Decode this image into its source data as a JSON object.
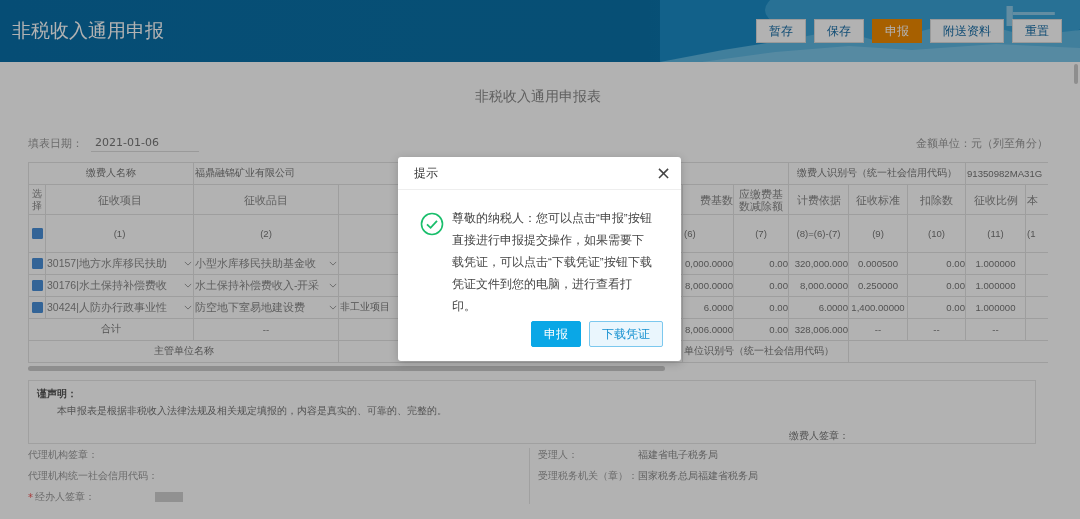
{
  "header": {
    "title": "非税收入通用申报",
    "buttons": [
      {
        "label": "暂存",
        "kind": "plain"
      },
      {
        "label": "保存",
        "kind": "plain"
      },
      {
        "label": "申报",
        "kind": "accent"
      },
      {
        "label": "附送资料",
        "kind": "plain"
      },
      {
        "label": "重置",
        "kind": "plain"
      }
    ]
  },
  "form": {
    "title": "非税收入通用申报表",
    "date_label": "填表日期：",
    "date_value": "2021-01-06",
    "unit_note": "金额单位：元（列至角分）",
    "payer_name_label": "缴费人名称",
    "payer_name": "福鼎融锦矿业有限公司",
    "payer_id_label": "缴费人识别号（统一社会信用代码）",
    "payer_id": "91350982MA31G",
    "columns": [
      {
        "label": "选择"
      },
      {
        "label": "征收项目",
        "number": "(1)"
      },
      {
        "label": "征收品目",
        "number": "(2)"
      },
      {
        "label": "费基数",
        "number": "(6)"
      },
      {
        "label": "应缴费基数减除额",
        "number": "(7)"
      },
      {
        "label": "计费依据",
        "number": "(8)=(6)-(7)"
      },
      {
        "label": "征收标准",
        "number": "(9)"
      },
      {
        "label": "扣除数",
        "number": "(10)"
      },
      {
        "label": "征收比例",
        "number": "(11)"
      },
      {
        "label": "本",
        "number": "(1"
      }
    ],
    "select_all_checked": true,
    "rows": [
      {
        "checked": true,
        "item": "30157|地方水库移民扶助",
        "category": "小型水库移民扶助基金收",
        "values": [
          "0,000.0000",
          "0.00",
          "320,000.000",
          "0.000500",
          "0.00",
          "1.000000"
        ]
      },
      {
        "checked": true,
        "item": "30176|水土保持补偿费收",
        "category": "水土保持补偿费收入-开采",
        "values": [
          "8,000.0000",
          "0.00",
          "8,000.0000",
          "0.250000",
          "0.00",
          "1.000000"
        ]
      },
      {
        "checked": true,
        "item": "30424|人防办行政事业性",
        "category": "防空地下室易地建设费",
        "note": "非工业项目",
        "values": [
          "6.0000",
          "0.00",
          "6.0000",
          "1,400.00000",
          "0.00",
          "1.000000"
        ]
      }
    ],
    "total": {
      "label": "合计",
      "category": "--",
      "values": [
        "8,006.0000",
        "0.00",
        "328,006.000",
        "--",
        "--",
        "--"
      ]
    },
    "authority_label": "主管单位名称",
    "authority_id_label": "单位识别号（统一社会信用代码）"
  },
  "declaration": {
    "title": "谨声明：",
    "text": "本申报表是根据非税收入法律法规及相关规定填报的，内容是真实的、可靠的、完整的。",
    "payer_sign_label": "缴费人签章："
  },
  "footer": {
    "left": [
      {
        "label": "代理机构签章：",
        "required": false
      },
      {
        "label": "代理机构统一社会信用代码：",
        "required": false
      },
      {
        "label": "经办人签章：",
        "required": true,
        "required_mark": "*",
        "blurred": true
      }
    ],
    "right": [
      {
        "label": "受理人：",
        "value": "福建省电子税务局"
      },
      {
        "label": "受理税务机关（章）：",
        "value": "国家税务总局福建省税务局"
      }
    ]
  },
  "dialog": {
    "title": "提示",
    "close": "×",
    "message": "尊敬的纳税人：您可以点击“申报”按钮直接进行申报提交操作，如果需要下载凭证，可以点击“下载凭证”按钮下载凭证文件到您的电脑，进行查看打印。",
    "buttons": [
      {
        "label": "申报",
        "kind": "primary"
      },
      {
        "label": "下载凭证",
        "kind": "secondary"
      }
    ]
  }
}
